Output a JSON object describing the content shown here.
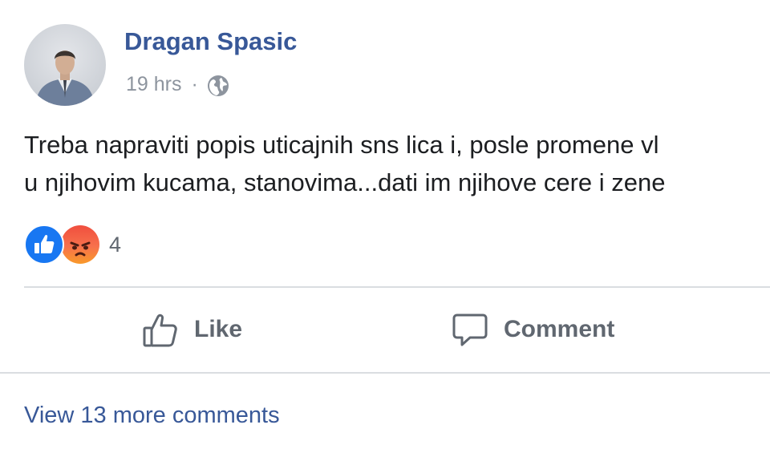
{
  "post": {
    "author": "Dragan Spasic",
    "timestamp": "19 hrs",
    "separator": "·",
    "privacy_icon": "globe-icon",
    "text_lines": [
      "Treba napraviti popis uticajnih sns lica i, posle promene vl",
      "u njihovim kucama, stanovima...dati im njihove cere i zene"
    ],
    "reactions": {
      "icons": [
        "like-reaction-icon",
        "angry-reaction-icon"
      ],
      "count": "4"
    },
    "actions": {
      "like_label": "Like",
      "comment_label": "Comment"
    },
    "view_more_comments": "View 13 more comments"
  },
  "colors": {
    "author_link": "#385898",
    "meta_text": "#8d949e",
    "body_text": "#1c1e21",
    "action_text": "#606770",
    "divider": "#dadde1",
    "like_blue": "#1877f2",
    "angry_orange": "#f7714c"
  }
}
